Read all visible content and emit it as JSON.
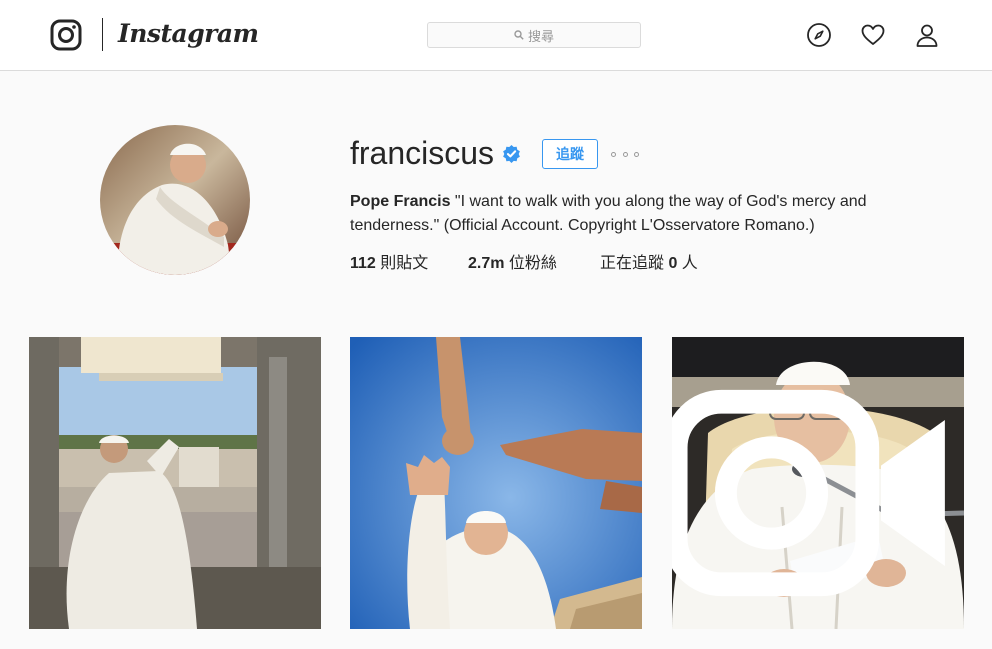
{
  "nav": {
    "logo_icon": "instagram-camera-icon",
    "wordmark": "Instagram",
    "search_placeholder": "搜尋",
    "search_icon": "search-icon",
    "explore_icon": "compass-icon",
    "activity_icon": "heart-icon",
    "profile_icon": "person-icon"
  },
  "profile": {
    "username": "franciscus",
    "verified_icon": "verified-badge-icon",
    "follow_label": "追蹤",
    "more_icon": "more-options-icon",
    "full_name": "Pope Francis",
    "bio": " \"I want to walk with you along the way of God's mercy and tenderness.\" (Official Account. Copyright L'Osservatore Romano.)",
    "stats": {
      "posts_count": "112",
      "posts_label": " 則貼文",
      "followers_count": "2.7m",
      "followers_label": " 位粉絲",
      "following_prefix": "正在追蹤 ",
      "following_count": "0",
      "following_suffix": " 人"
    }
  },
  "posts": [
    {
      "type": "photo"
    },
    {
      "type": "photo"
    },
    {
      "type": "video",
      "badge_icon": "video-camera-icon"
    }
  ],
  "colors": {
    "accent": "#3897f0",
    "background": "#fafafa",
    "border": "#dbdbdb",
    "text": "#262626"
  }
}
